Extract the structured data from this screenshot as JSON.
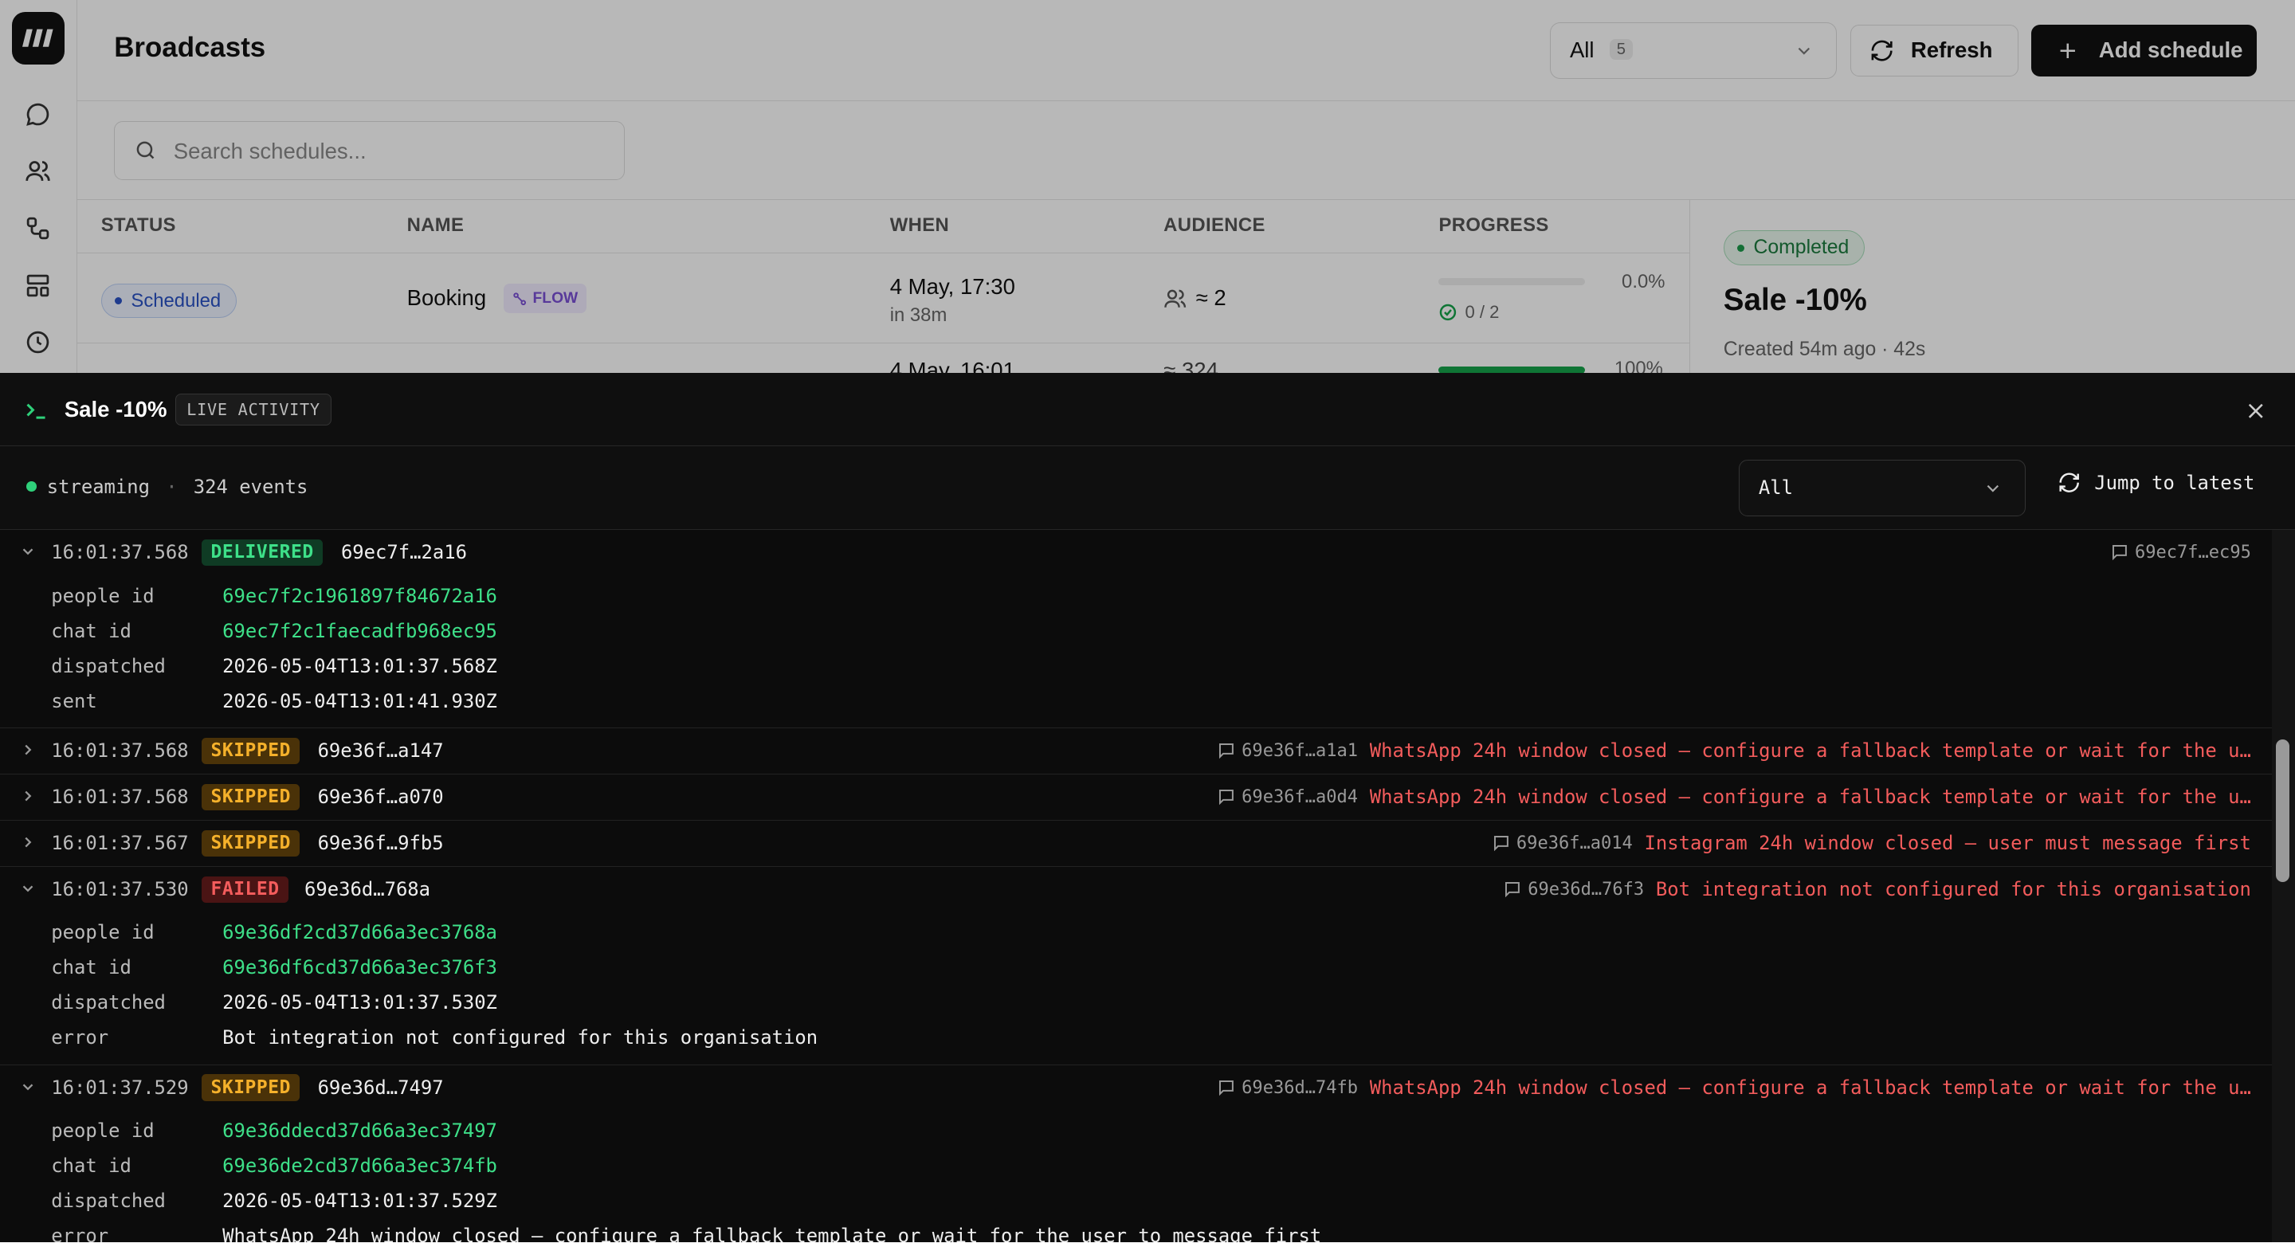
{
  "header": {
    "title": "Broadcasts",
    "filter": {
      "label": "All",
      "count": "5"
    },
    "refresh_label": "Refresh",
    "add_label": "Add schedule"
  },
  "search": {
    "placeholder": "Search schedules..."
  },
  "table": {
    "columns": [
      "STATUS",
      "NAME",
      "WHEN",
      "AUDIENCE",
      "PROGRESS"
    ],
    "rows": [
      {
        "status": "Scheduled",
        "name": "Booking",
        "tag": "FLOW",
        "when": "4 May, 17:30",
        "when_sub": "in 38m",
        "audience": "≈ 2",
        "progress_pct": "0.0%",
        "progress_count": "0 / 2",
        "progress_fraction": 0
      },
      {
        "when": "4 May, 16:01",
        "audience": "≈ 324",
        "progress_pct": "100%",
        "progress_fraction": 1
      }
    ]
  },
  "side_panel": {
    "status": "Completed",
    "title": "Sale -10%",
    "subtitle": "Created 54m ago · 42s"
  },
  "activity": {
    "title": "Sale -10%",
    "tag": "LIVE ACTIVITY",
    "status": "streaming",
    "separator": "·",
    "events_count": "324 events",
    "filter_value": "All",
    "jump_label": "Jump to latest",
    "detail_labels": {
      "people_id": "people id",
      "chat_id": "chat id",
      "dispatched": "dispatched",
      "sent": "sent",
      "error": "error"
    },
    "events": [
      {
        "time": "16:01:37.568",
        "status": "DELIVERED",
        "id": "69ec7f…2a16",
        "chat_ref": "69ec7f…ec95",
        "message": "",
        "expanded": true,
        "people_id": "69ec7f2c1961897f84672a16",
        "chat_id": "69ec7f2c1faecadfb968ec95",
        "dispatched": "2026-05-04T13:01:37.568Z",
        "sent": "2026-05-04T13:01:41.930Z"
      },
      {
        "time": "16:01:37.568",
        "status": "SKIPPED",
        "id": "69e36f…a147",
        "chat_ref": "69e36f…a1a1",
        "message": "WhatsApp 24h window closed — configure a fallback template or wait for the u…",
        "expanded": false
      },
      {
        "time": "16:01:37.568",
        "status": "SKIPPED",
        "id": "69e36f…a070",
        "chat_ref": "69e36f…a0d4",
        "message": "WhatsApp 24h window closed — configure a fallback template or wait for the u…",
        "expanded": false
      },
      {
        "time": "16:01:37.567",
        "status": "SKIPPED",
        "id": "69e36f…9fb5",
        "chat_ref": "69e36f…a014",
        "message": "Instagram 24h window closed — user must message first",
        "expanded": false
      },
      {
        "time": "16:01:37.530",
        "status": "FAILED",
        "id": "69e36d…768a",
        "chat_ref": "69e36d…76f3",
        "message": "Bot integration not configured for this organisation",
        "expanded": true,
        "people_id": "69e36df2cd37d66a3ec3768a",
        "chat_id": "69e36df6cd37d66a3ec376f3",
        "dispatched": "2026-05-04T13:01:37.530Z",
        "error": "Bot integration not configured for this organisation"
      },
      {
        "time": "16:01:37.529",
        "status": "SKIPPED",
        "id": "69e36d…7497",
        "chat_ref": "69e36d…74fb",
        "message": "WhatsApp 24h window closed — configure a fallback template or wait for the u…",
        "expanded": true,
        "people_id": "69e36ddecd37d66a3ec37497",
        "chat_id": "69e36de2cd37d66a3ec374fb",
        "dispatched": "2026-05-04T13:01:37.529Z",
        "error": "WhatsApp 24h window closed — configure a fallback template or wait for the user to message first"
      }
    ]
  },
  "colors": {
    "delivered": "#3ee089",
    "skipped": "#f5b12b",
    "failed": "#f35c5c",
    "scheduled": "#2a53c5",
    "completed": "#1b7a3d"
  },
  "icons": {
    "rail": [
      "chat-bubble-icon",
      "users-icon",
      "flow-icon",
      "layout-icon",
      "clock-icon"
    ],
    "chat_ref": "message-square-icon"
  }
}
